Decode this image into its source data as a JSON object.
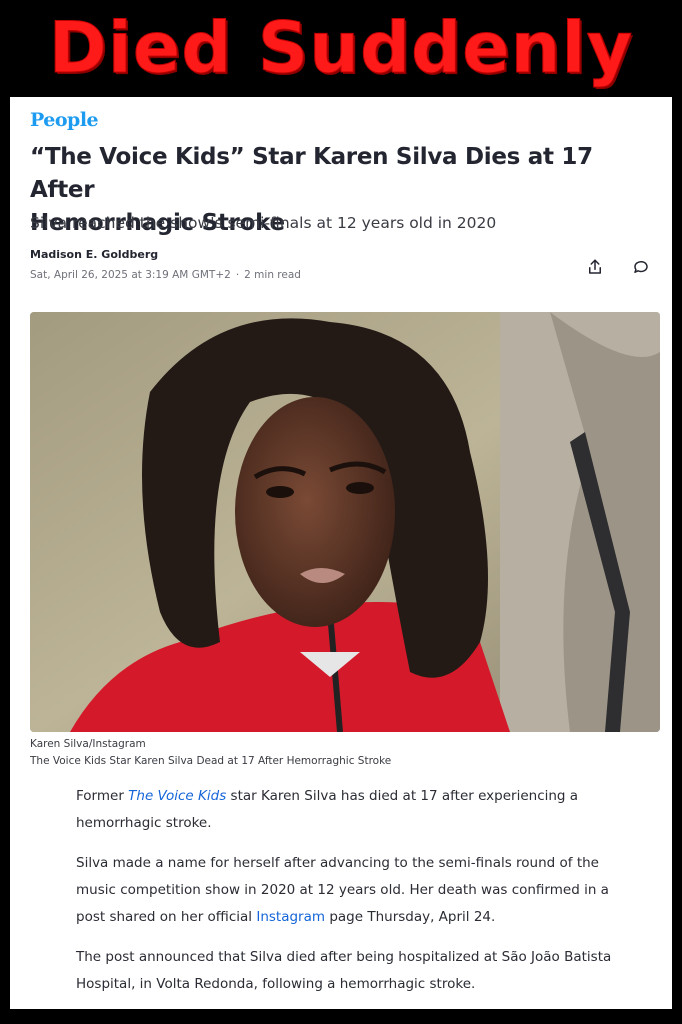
{
  "banner": {
    "text": "Died Suddenly",
    "color": "#ff1a1a"
  },
  "article": {
    "brand": "People",
    "headline_line1": "“The Voice Kids” Star Karen Silva Dies at 17 After",
    "headline_line2": "Hemorrhagic Stroke",
    "subheadline": "Silva reached the show's semi-finals at 12 years old in 2020",
    "author": "Madison E. Goldberg",
    "date": "Sat, April 26, 2025 at 3:19 AM GMT+2",
    "read_time": "2 min read",
    "separator": "·",
    "actions": {
      "share_icon": "share-icon",
      "comment_icon": "comment-icon"
    },
    "image": {
      "credit": "Karen Silva/Instagram",
      "caption": "The Voice Kids Star Karen Silva Dead at 17 After Hemorraghic Stroke"
    },
    "p1": {
      "before": "Former ",
      "link": "The Voice Kids",
      "after": " star Karen Silva has died at 17 after experiencing a hemorrhagic stroke."
    },
    "p2": {
      "before": "Silva made a name for herself after advancing to the semi-finals round of the music competition show in 2020 at 12 years old. Her death was confirmed in a post shared on her official ",
      "link": "Instagram",
      "after": " page Thursday, April 24."
    },
    "p3": "The post announced that Silva died after being hospitalized at São João Batista Hospital, in Volta Redonda, following a hemorrhagic stroke.",
    "colors": {
      "brand": "#1d9bf0",
      "link": "#1565d8",
      "text": "#232530"
    }
  }
}
